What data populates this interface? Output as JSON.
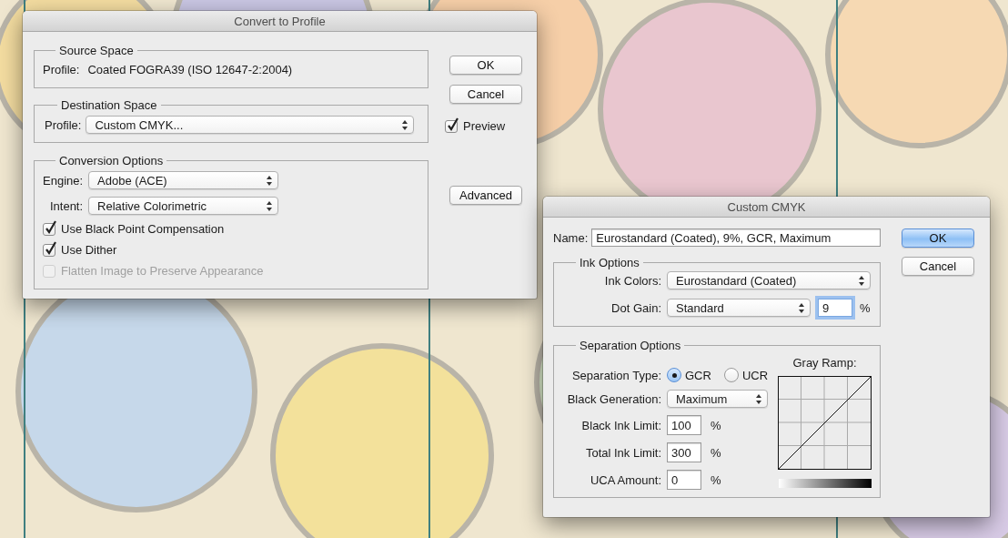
{
  "convert_dialog": {
    "title": "Convert to Profile",
    "source_space": {
      "legend": "Source Space",
      "profile_label": "Profile:",
      "profile_value": "Coated FOGRA39 (ISO 12647-2:2004)"
    },
    "destination_space": {
      "legend": "Destination Space",
      "profile_label": "Profile:",
      "profile_value": "Custom CMYK..."
    },
    "conversion_options": {
      "legend": "Conversion Options",
      "engine_label": "Engine:",
      "engine_value": "Adobe (ACE)",
      "intent_label": "Intent:",
      "intent_value": "Relative Colorimetric",
      "checkboxes": [
        {
          "label": "Use Black Point Compensation",
          "checked": true,
          "disabled": false
        },
        {
          "label": "Use Dither",
          "checked": true,
          "disabled": false
        },
        {
          "label": "Flatten Image to Preserve Appearance",
          "checked": false,
          "disabled": true
        }
      ]
    },
    "buttons": [
      {
        "label": "OK",
        "default": false
      },
      {
        "label": "Cancel",
        "default": false
      }
    ],
    "preview": {
      "label": "Preview",
      "checked": true
    },
    "advanced_button": "Advanced"
  },
  "custom_cmyk_dialog": {
    "title": "Custom CMYK",
    "name_label": "Name:",
    "name_value": "Eurostandard (Coated), 9%, GCR, Maximum",
    "buttons": [
      {
        "label": "OK",
        "default": true
      },
      {
        "label": "Cancel",
        "default": false
      }
    ],
    "ink_options": {
      "legend": "Ink Options",
      "ink_colors_label": "Ink Colors:",
      "ink_colors_value": "Eurostandard (Coated)",
      "dot_gain_label": "Dot Gain:",
      "dot_gain_value": "Standard",
      "dot_gain_amount": "9",
      "dot_gain_focused": true,
      "dot_gain_unit": "%"
    },
    "separation_options": {
      "legend": "Separation Options",
      "separation_type_label": "Separation Type:",
      "radios": [
        {
          "label": "GCR",
          "selected": true
        },
        {
          "label": "UCR",
          "selected": false
        }
      ],
      "black_generation_label": "Black Generation:",
      "black_generation_value": "Maximum",
      "limits": [
        {
          "label": "Black Ink Limit:",
          "value": "100",
          "unit": "%"
        },
        {
          "label": "Total Ink Limit:",
          "value": "300",
          "unit": "%"
        },
        {
          "label": "UCA Amount:",
          "value": "0",
          "unit": "%"
        }
      ],
      "gray_ramp_label": "Gray Ramp:"
    }
  }
}
